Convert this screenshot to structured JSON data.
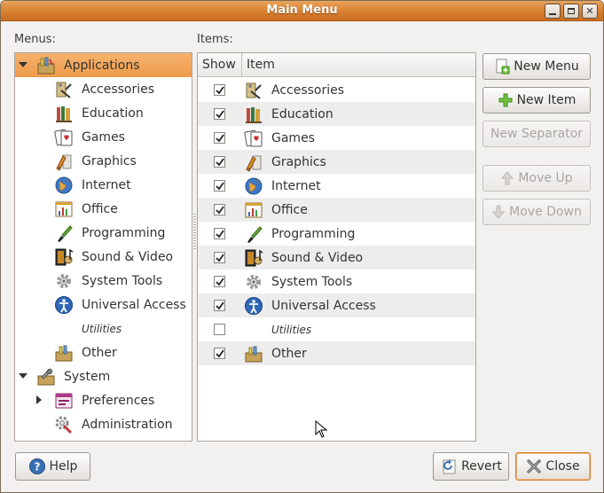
{
  "window": {
    "title": "Main Menu",
    "controls": [
      "minimize",
      "maximize",
      "close"
    ]
  },
  "menus": {
    "label": "Menus:",
    "tree": [
      {
        "label": "Applications",
        "icon": "applications-icon",
        "expander": "down",
        "selected": true,
        "level": 0
      },
      {
        "label": "Accessories",
        "icon": "accessories-icon",
        "level": 1
      },
      {
        "label": "Education",
        "icon": "education-icon",
        "level": 1
      },
      {
        "label": "Games",
        "icon": "games-icon",
        "level": 1
      },
      {
        "label": "Graphics",
        "icon": "graphics-icon",
        "level": 1
      },
      {
        "label": "Internet",
        "icon": "internet-icon",
        "level": 1
      },
      {
        "label": "Office",
        "icon": "office-icon",
        "level": 1
      },
      {
        "label": "Programming",
        "icon": "programming-icon",
        "level": 1
      },
      {
        "label": "Sound & Video",
        "icon": "sound-video-icon",
        "level": 1
      },
      {
        "label": "System Tools",
        "icon": "system-tools-icon",
        "level": 1
      },
      {
        "label": "Universal Access",
        "icon": "universal-access-icon",
        "level": 1
      },
      {
        "label": "Utilities",
        "icon": "",
        "level": 1,
        "italic": true
      },
      {
        "label": "Other",
        "icon": "other-icon",
        "level": 1
      },
      {
        "label": "System",
        "icon": "system-icon",
        "expander": "down",
        "level": 0
      },
      {
        "label": "Preferences",
        "icon": "preferences-icon",
        "expander": "right",
        "level": 1
      },
      {
        "label": "Administration",
        "icon": "administration-icon",
        "level": 1
      }
    ]
  },
  "items": {
    "label": "Items:",
    "headers": {
      "show": "Show",
      "item": "Item"
    },
    "rows": [
      {
        "label": "Accessories",
        "checked": true,
        "icon": "accessories-icon"
      },
      {
        "label": "Education",
        "checked": true,
        "icon": "education-icon"
      },
      {
        "label": "Games",
        "checked": true,
        "icon": "games-icon"
      },
      {
        "label": "Graphics",
        "checked": true,
        "icon": "graphics-icon"
      },
      {
        "label": "Internet",
        "checked": true,
        "icon": "internet-icon"
      },
      {
        "label": "Office",
        "checked": true,
        "icon": "office-icon"
      },
      {
        "label": "Programming",
        "checked": true,
        "icon": "programming-icon"
      },
      {
        "label": "Sound & Video",
        "checked": true,
        "icon": "sound-video-icon"
      },
      {
        "label": "System Tools",
        "checked": true,
        "icon": "system-tools-icon"
      },
      {
        "label": "Universal Access",
        "checked": true,
        "icon": "universal-access-icon"
      },
      {
        "label": "Utilities",
        "checked": false,
        "icon": "",
        "italic": true
      },
      {
        "label": "Other",
        "checked": true,
        "icon": "other-icon"
      }
    ]
  },
  "actions": {
    "new_menu": "New Menu",
    "new_item": "New Item",
    "new_separator": "New Separator",
    "move_up": "Move Up",
    "move_down": "Move Down"
  },
  "footer": {
    "help": "Help",
    "revert": "Revert",
    "close": "Close"
  },
  "colors": {
    "titlebar": "#d97f2f",
    "selection": "#f0a050",
    "window_bg": "#f2f1f0"
  }
}
